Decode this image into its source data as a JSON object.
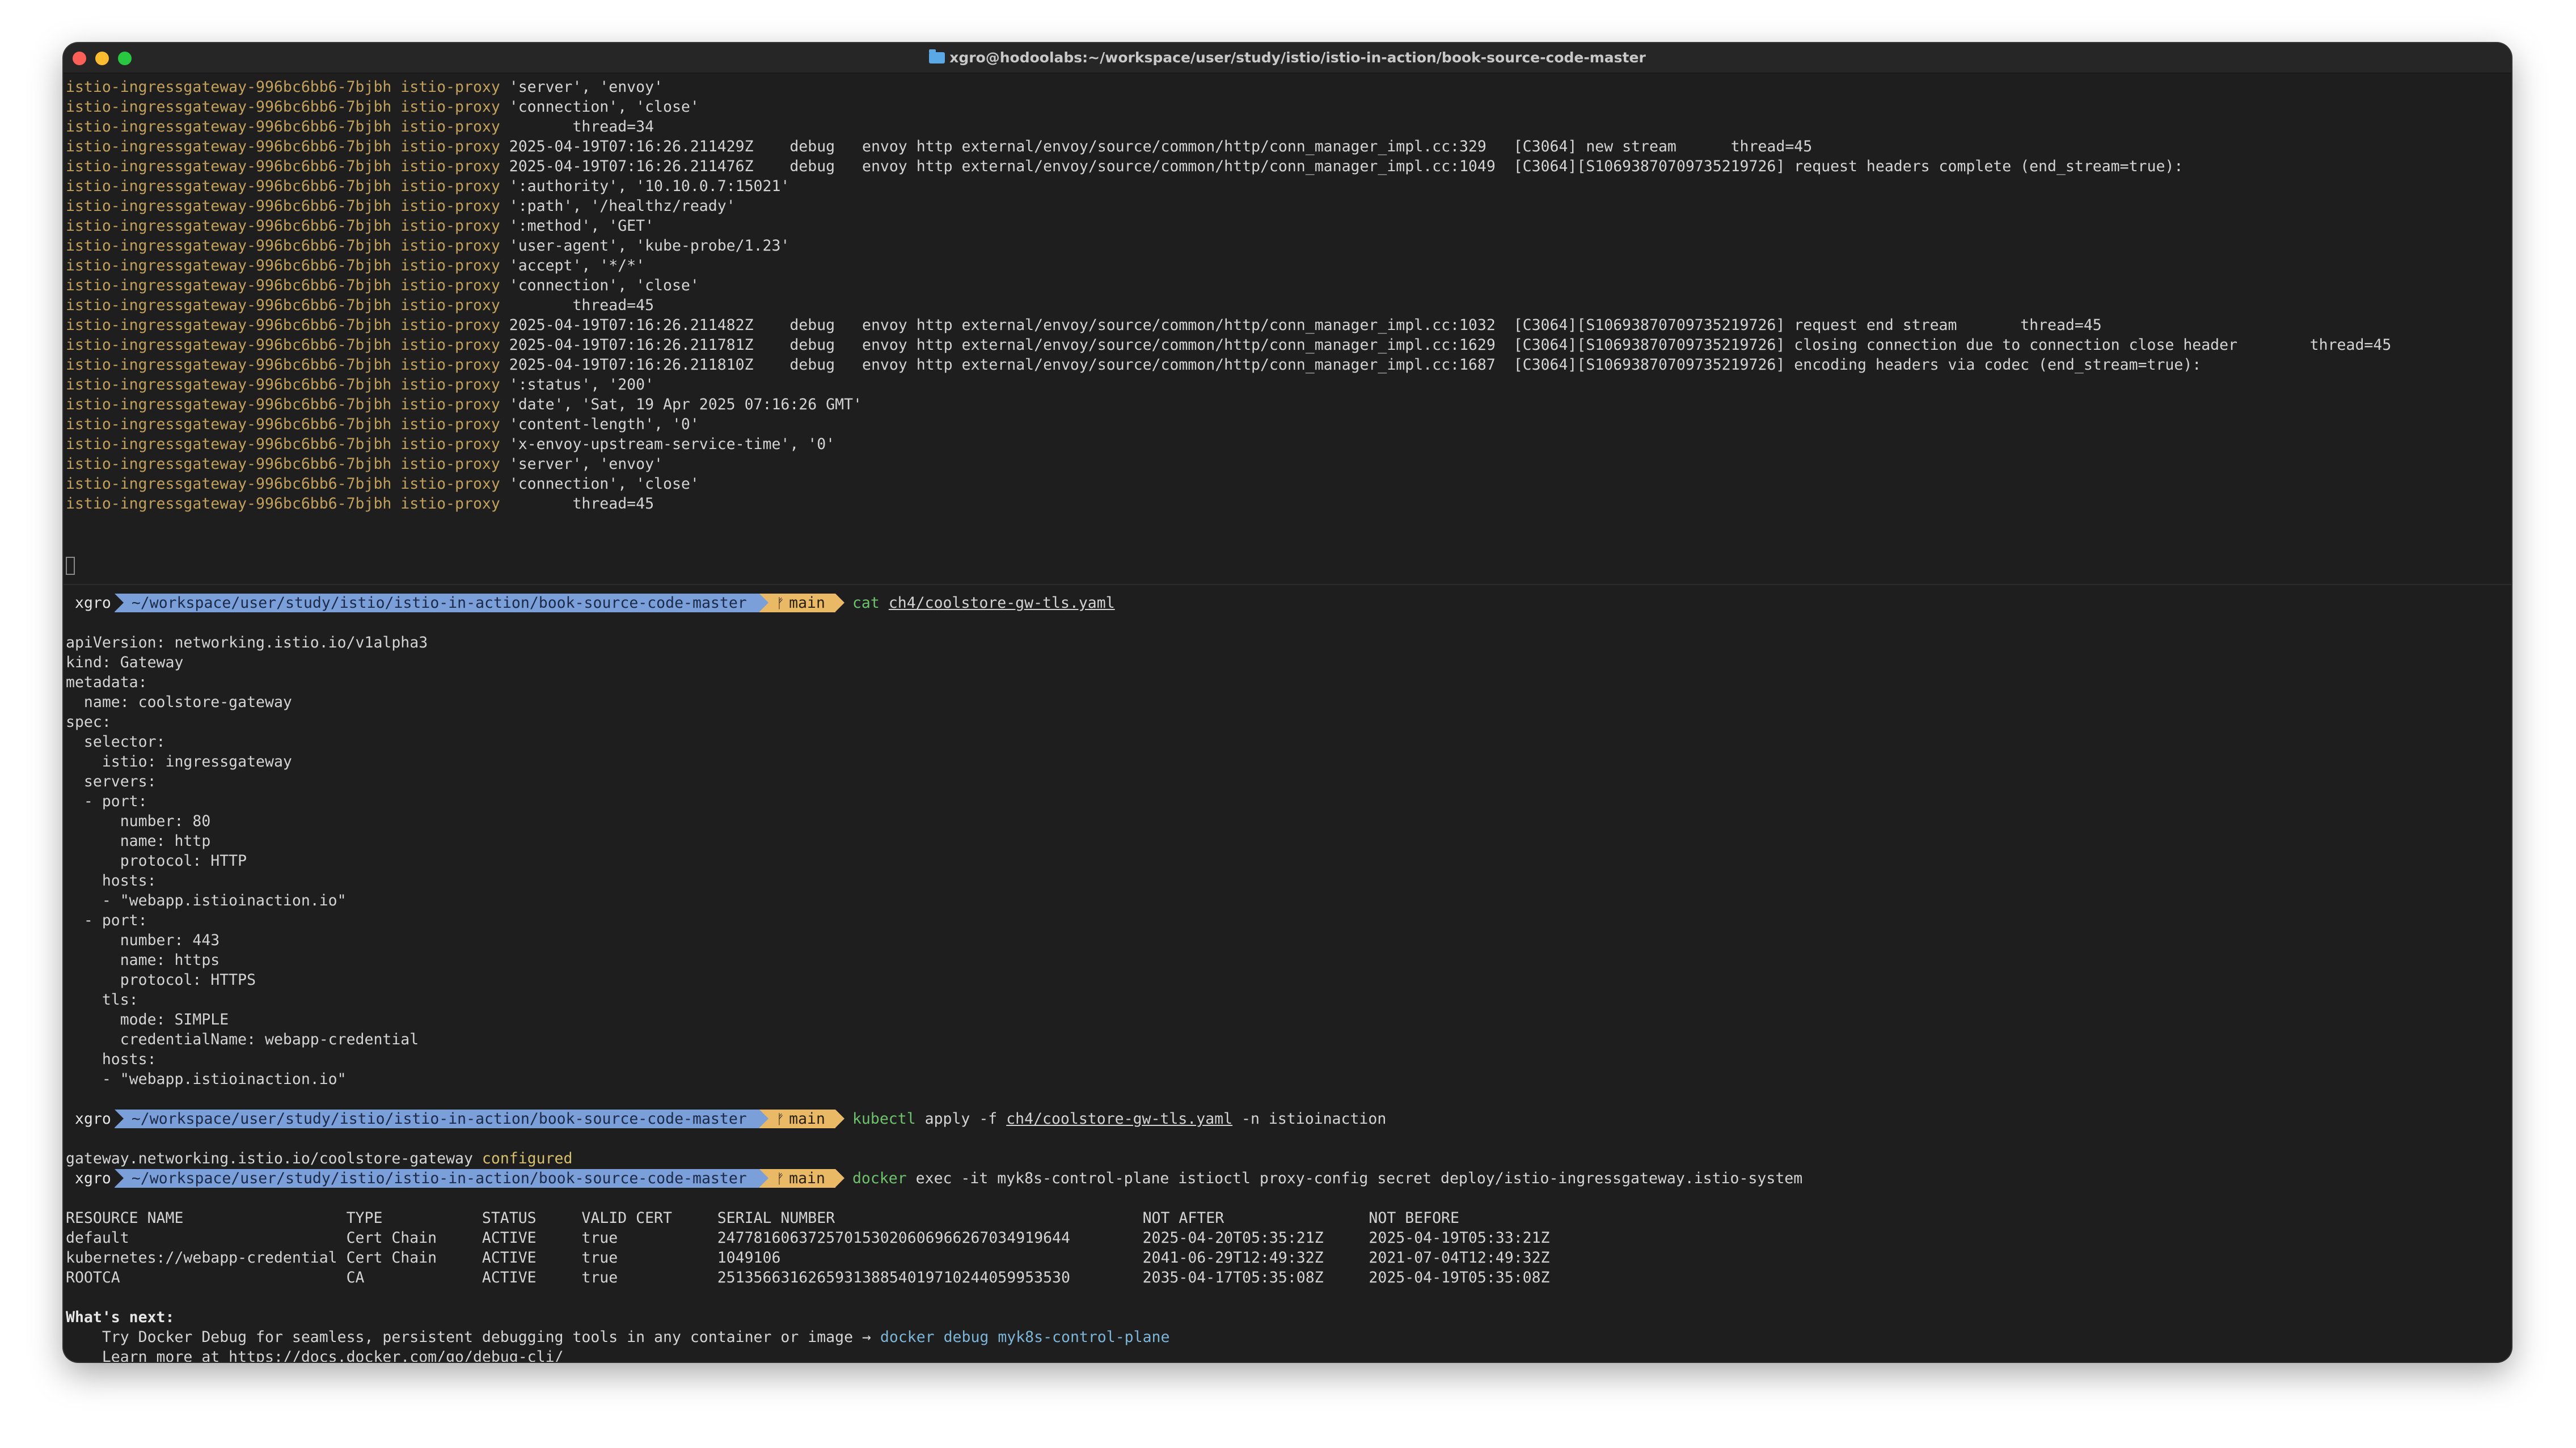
{
  "window": {
    "title": "xgro@hodoolabs:~/workspace/user/study/istio/istio-in-action/book-source-code-master"
  },
  "top_pane": {
    "pod": "istio-ingressgateway-996bc6bb6-7bjbh istio-proxy",
    "lines": [
      " 'server', 'envoy'",
      " 'connection', 'close'",
      "        thread=34",
      " 2025-04-19T07:16:26.211429Z    debug   envoy http external/envoy/source/common/http/conn_manager_impl.cc:329   [C3064] new stream      thread=45",
      " 2025-04-19T07:16:26.211476Z    debug   envoy http external/envoy/source/common/http/conn_manager_impl.cc:1049  [C3064][S10693870709735219726] request headers complete (end_stream=true):",
      " ':authority', '10.10.0.7:15021'",
      " ':path', '/healthz/ready'",
      " ':method', 'GET'",
      " 'user-agent', 'kube-probe/1.23'",
      " 'accept', '*/*'",
      " 'connection', 'close'",
      "        thread=45",
      " 2025-04-19T07:16:26.211482Z    debug   envoy http external/envoy/source/common/http/conn_manager_impl.cc:1032  [C3064][S10693870709735219726] request end stream       thread=45",
      " 2025-04-19T07:16:26.211781Z    debug   envoy http external/envoy/source/common/http/conn_manager_impl.cc:1629  [C3064][S10693870709735219726] closing connection due to connection close header        thread=45",
      " 2025-04-19T07:16:26.211810Z    debug   envoy http external/envoy/source/common/http/conn_manager_impl.cc:1687  [C3064][S10693870709735219726] encoding headers via codec (end_stream=true):",
      " ':status', '200'",
      " 'date', 'Sat, 19 Apr 2025 07:16:26 GMT'",
      " 'content-length', '0'",
      " 'x-envoy-upstream-service-time', '0'",
      " 'server', 'envoy'",
      " 'connection', 'close'",
      "        thread=45"
    ]
  },
  "prompt": {
    "user": "xgro",
    "path": "~/workspace/user/study/istio/istio-in-action/book-source-code-master",
    "branch": "main"
  },
  "commands": {
    "c1": {
      "name": "cat",
      "arg": "ch4/coolstore-gw-tls.yaml"
    },
    "c2": {
      "name": "kubectl",
      "pre": " apply -f ",
      "arg": "ch4/coolstore-gw-tls.yaml",
      "post": " -n istioinaction"
    },
    "c3": {
      "name": "docker",
      "rest": " exec -it myk8s-control-plane istioctl proxy-config secret deploy/istio-ingressgateway.istio-system"
    }
  },
  "yaml_lines": [
    "apiVersion: networking.istio.io/v1alpha3",
    "kind: Gateway",
    "metadata:",
    "  name: coolstore-gateway",
    "spec:",
    "  selector:",
    "    istio: ingressgateway",
    "  servers:",
    "  - port:",
    "      number: 80",
    "      name: http",
    "      protocol: HTTP",
    "    hosts:",
    "    - \"webapp.istioinaction.io\"",
    "  - port:",
    "      number: 443",
    "      name: https",
    "      protocol: HTTPS",
    "    tls:",
    "      mode: SIMPLE",
    "      credentialName: webapp-credential",
    "    hosts:",
    "    - \"webapp.istioinaction.io\""
  ],
  "apply_output": {
    "resource": "gateway.networking.istio.io/coolstore-gateway ",
    "status": "configured"
  },
  "secret_table": {
    "header": "RESOURCE NAME                  TYPE           STATUS     VALID CERT     SERIAL NUMBER                                  NOT AFTER                NOT BEFORE",
    "rows": [
      "default                        Cert Chain     ACTIVE     true           247781606372570153020606966267034919644        2025-04-20T05:35:21Z     2025-04-19T05:33:21Z",
      "kubernetes://webapp-credential Cert Chain     ACTIVE     true           1049106                                        2041-06-29T12:49:32Z     2021-07-04T12:49:32Z",
      "ROOTCA                         CA             ACTIVE     true           251356631626593138854019710244059953530        2035-04-17T05:35:08Z     2025-04-19T05:35:08Z"
    ]
  },
  "whats_next": {
    "title": "What's next:",
    "line1_text": "    Try Docker Debug for seamless, persistent debugging tools in any container or image → ",
    "line1_cmd": "docker debug myk8s-control-plane",
    "line2": "    Learn more at https://docs.docker.com/go/debug-cli/"
  }
}
